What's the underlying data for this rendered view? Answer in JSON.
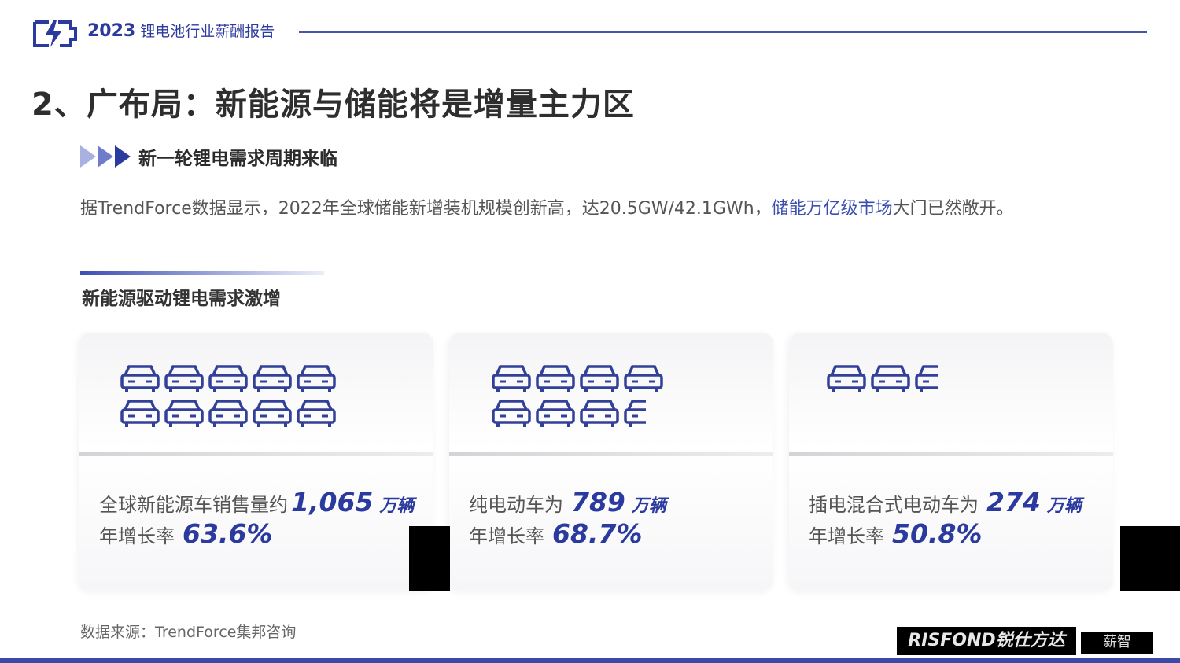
{
  "header": {
    "year": "2023",
    "title": "锂电池行业薪酬报告"
  },
  "page_title": "2、广布局：新能源与储能将是增量主力区",
  "subheading": "新一轮锂电需求周期来临",
  "intro": {
    "before": "据TrendForce数据显示，2022年全球储能新增装机规模创新高，达20.5GW/42.1GWh，",
    "highlight": "储能万亿级市场",
    "after": "大门已然敞开。"
  },
  "section_title": "新能源驱动锂电需求激增",
  "cards": [
    {
      "label": "全球新能源车销售量约",
      "value": "1,065",
      "unit": "万辆",
      "growth_label": "年增长率",
      "growth": "63.6%",
      "car_icons": 10
    },
    {
      "label": "纯电动车为",
      "value": "789",
      "unit": "万辆",
      "growth_label": "年增长率",
      "growth": "68.7%",
      "car_icons": 7.5
    },
    {
      "label": "插电混合式电动车为",
      "value": "274",
      "unit": "万辆",
      "growth_label": "年增长率",
      "growth": "50.8%",
      "car_icons": 2.5
    }
  ],
  "source": "数据来源：TrendForce集邦咨询",
  "watermark": {
    "brand": "RISFOND锐仕方达",
    "secondary": "薪智"
  },
  "colors": {
    "accent": "#2b3a9e",
    "icon": "#33409a",
    "bottom_bar": "#3b4aa8"
  },
  "icons": {
    "logo": "battery-bolt-icon",
    "car": "car-icon",
    "arrows": "triple-arrow-icon"
  }
}
